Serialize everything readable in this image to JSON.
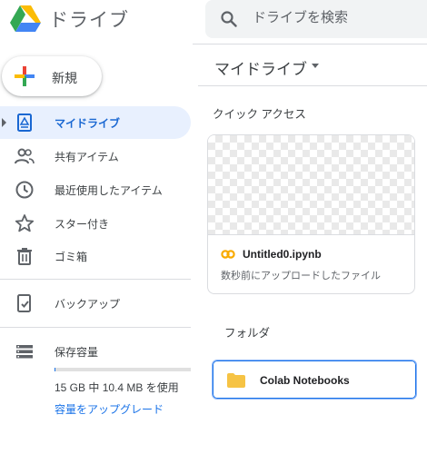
{
  "app": {
    "title": "ドライブ"
  },
  "search": {
    "placeholder": "ドライブを検索"
  },
  "new_button": {
    "label": "新規"
  },
  "sidebar": {
    "items": [
      {
        "label": "マイドライブ",
        "icon": "my-drive-icon",
        "active": true
      },
      {
        "label": "共有アイテム",
        "icon": "people-icon"
      },
      {
        "label": "最近使用したアイテム",
        "icon": "clock-icon"
      },
      {
        "label": "スター付き",
        "icon": "star-icon"
      },
      {
        "label": "ゴミ箱",
        "icon": "trash-icon"
      },
      {
        "label": "バックアップ",
        "icon": "backup-icon"
      },
      {
        "label": "保存容量",
        "icon": "storage-icon"
      }
    ],
    "storage": {
      "used_text": "15 GB 中 10.4 MB を使用",
      "used_fraction": 0.0007,
      "upgrade_label": "容量をアップグレード"
    }
  },
  "main": {
    "title": "マイドライブ",
    "quick_access": {
      "heading": "クイック アクセス",
      "files": [
        {
          "name": "Untitled0.ipynb",
          "reason": "数秒前にアップロードしたファイル",
          "icon": "colab-icon"
        }
      ]
    },
    "folders": {
      "heading": "フォルダ",
      "items": [
        {
          "name": "Colab Notebooks",
          "icon": "folder-icon"
        }
      ]
    }
  },
  "colors": {
    "accent": "#1a73e8",
    "active_bg": "#e8f0fe",
    "folder": "#f6c344",
    "colab": "#f9ab00"
  }
}
